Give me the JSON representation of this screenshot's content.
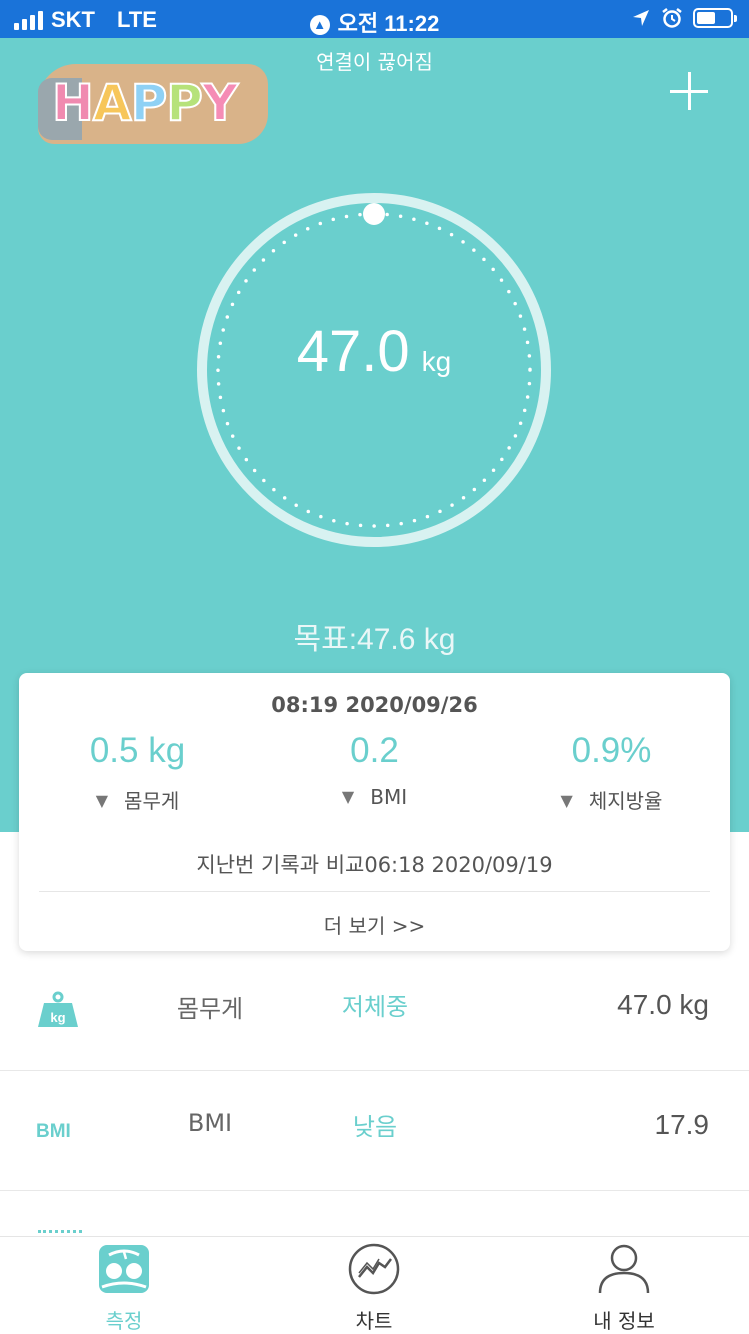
{
  "status_bar": {
    "carrier": "SKT",
    "network": "LTE",
    "time": "오전 11:22"
  },
  "header": {
    "connection_status": "연결이 끊어짐",
    "logo_text": "HAPPY",
    "add_icon": "plus-icon"
  },
  "gauge": {
    "weight_value": "47.0",
    "weight_unit": "kg",
    "goal_text": "목표:47.6 kg"
  },
  "summary_card": {
    "datetime": "08:19 2020/09/26",
    "metrics": [
      {
        "value": "0.5 kg",
        "label": "몸무게",
        "trend": "down"
      },
      {
        "value": "0.2",
        "label": "BMI",
        "trend": "down"
      },
      {
        "value": "0.9%",
        "label": "체지방율",
        "trend": "down"
      }
    ],
    "comparison_text": "지난번 기록과 비교06:18 2020/09/19",
    "more_link": "더 보기 >>"
  },
  "measure_list": [
    {
      "icon_label": "kg",
      "name": "몸무게",
      "status": "저체중",
      "value": "47.0 kg"
    },
    {
      "icon_label": "BMI",
      "name": "BMI",
      "status": "낮음",
      "value": "17.9"
    }
  ],
  "tab_bar": {
    "tabs": [
      {
        "label": "측정",
        "icon": "scale-icon",
        "active": true
      },
      {
        "label": "차트",
        "icon": "chart-icon",
        "active": false
      },
      {
        "label": "내 정보",
        "icon": "profile-icon",
        "active": false
      }
    ]
  },
  "colors": {
    "accent": "#6acfcd",
    "status_bar": "#1a73d9",
    "text": "#555555"
  }
}
